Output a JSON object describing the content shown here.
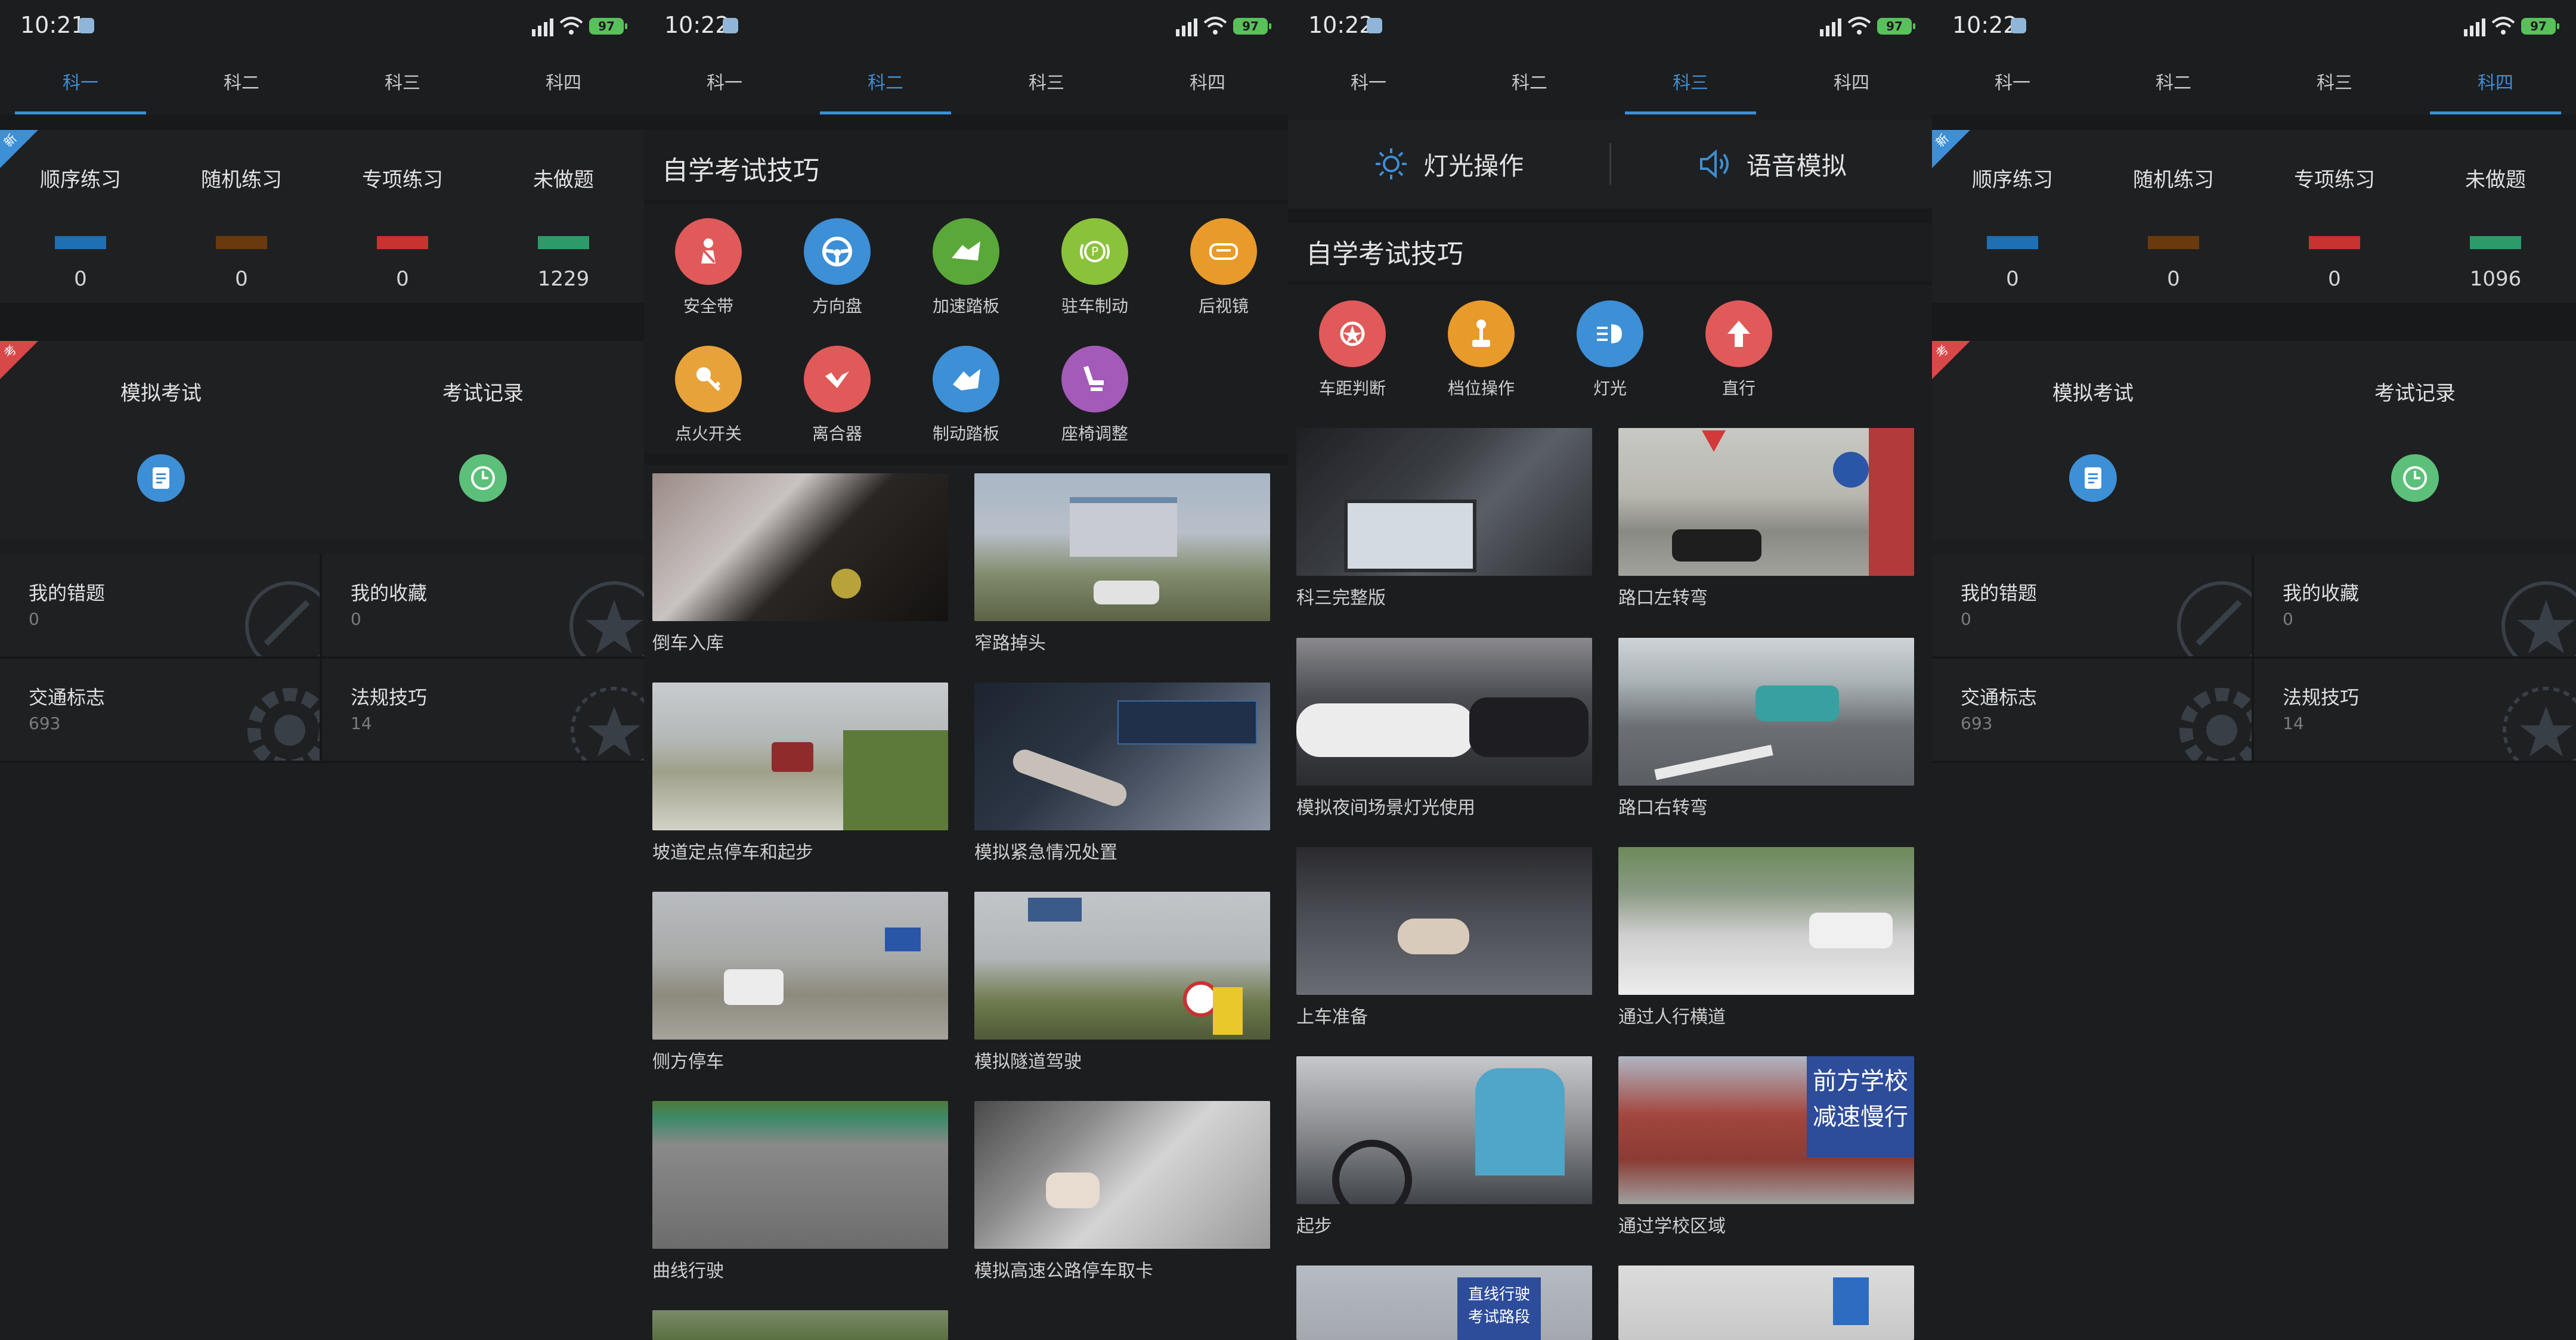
{
  "battery": "97",
  "tabs": [
    "科一",
    "科二",
    "科三",
    "科四"
  ],
  "screens": {
    "s1": {
      "time": "10:21",
      "active_tab": 0
    },
    "s2": {
      "time": "10:22",
      "active_tab": 1
    },
    "s3": {
      "time": "10:22",
      "active_tab": 2
    },
    "s4": {
      "time": "10:22",
      "active_tab": 3
    }
  },
  "practice": {
    "labels": [
      "顺序练习",
      "随机练习",
      "专项练习",
      "未做题"
    ],
    "bar_colors": [
      "#1e6fb3",
      "#6a3a0e",
      "#c8322f",
      "#2d9a6a"
    ],
    "s1_counts": [
      "0",
      "0",
      "0",
      "1229"
    ],
    "s4_counts": [
      "0",
      "0",
      "0",
      "1096"
    ],
    "badge_new": "新",
    "badge_exam": "考"
  },
  "exam": {
    "mock": "模拟考试",
    "record": "考试记录"
  },
  "grid": [
    {
      "title": "我的错题",
      "num": "0"
    },
    {
      "title": "我的收藏",
      "num": "0"
    },
    {
      "title": "交通标志",
      "num": "693"
    },
    {
      "title": "法规技巧",
      "num": "14"
    }
  ],
  "sub2": {
    "heading": "自学考试技巧",
    "icons": [
      {
        "label": "安全带",
        "color": "#e05a5a"
      },
      {
        "label": "方向盘",
        "color": "#3d8fd6"
      },
      {
        "label": "加速踏板",
        "color": "#5aa83a"
      },
      {
        "label": "驻车制动",
        "color": "#8ac23a"
      },
      {
        "label": "后视镜",
        "color": "#e89a2a"
      },
      {
        "label": "点火开关",
        "color": "#e8a23a"
      },
      {
        "label": "离合器",
        "color": "#e05a5a"
      },
      {
        "label": "制动踏板",
        "color": "#3d8fd6"
      },
      {
        "label": "座椅调整",
        "color": "#a35ab8"
      }
    ],
    "videos": [
      "倒车入库",
      "窄路掉头",
      "坡道定点停车和起步",
      "模拟紧急情况处置",
      "侧方停车",
      "模拟隧道驾驶",
      "曲线行驶",
      "模拟高速公路停车取卡"
    ]
  },
  "sub3": {
    "light_op": "灯光操作",
    "voice_sim": "语音模拟",
    "heading": "自学考试技巧",
    "icons": [
      {
        "label": "车距判断",
        "color": "#e05a5a"
      },
      {
        "label": "档位操作",
        "color": "#e89a2a"
      },
      {
        "label": "灯光",
        "color": "#3d8fd6"
      },
      {
        "label": "直行",
        "color": "#e05a5a"
      }
    ],
    "videos": [
      "科三完整版",
      "路口左转弯",
      "模拟夜间场景灯光使用",
      "路口右转弯",
      "上车准备",
      "通过人行横道",
      "起步",
      "通过学校区域"
    ],
    "sign_text_1": "前方学校",
    "sign_text_2": "减速慢行",
    "sign_text_3": "直线行驶",
    "sign_text_4": "考试路段"
  }
}
